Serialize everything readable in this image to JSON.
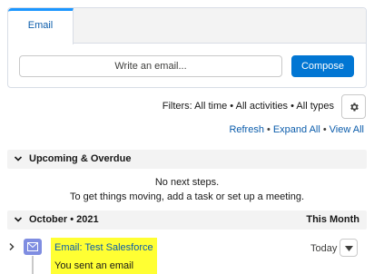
{
  "tabs": [
    {
      "label": "Email"
    }
  ],
  "composer": {
    "placeholder": "Write an email...",
    "button_label": "Compose"
  },
  "filters": {
    "text": "Filters: All time • All activities • All types",
    "settings_icon": "gear-icon"
  },
  "links": {
    "refresh": "Refresh",
    "expand_all": "Expand All",
    "view_all": "View All",
    "separator": "•"
  },
  "upcoming": {
    "title": "Upcoming & Overdue",
    "empty_title": "No next steps.",
    "empty_sub": "To get things moving, add a task or set up a meeting."
  },
  "month_group": {
    "title": "October • 2021",
    "right_label": "This Month",
    "items": [
      {
        "type_icon": "email-icon",
        "subject": "Email: Test Salesforce",
        "description": "You sent an email",
        "date": "Today",
        "highlight_color": "#ffff33"
      }
    ]
  },
  "colors": {
    "brand": "#0176d3",
    "link": "#0b5cab",
    "email_icon": "#7f8de1"
  }
}
